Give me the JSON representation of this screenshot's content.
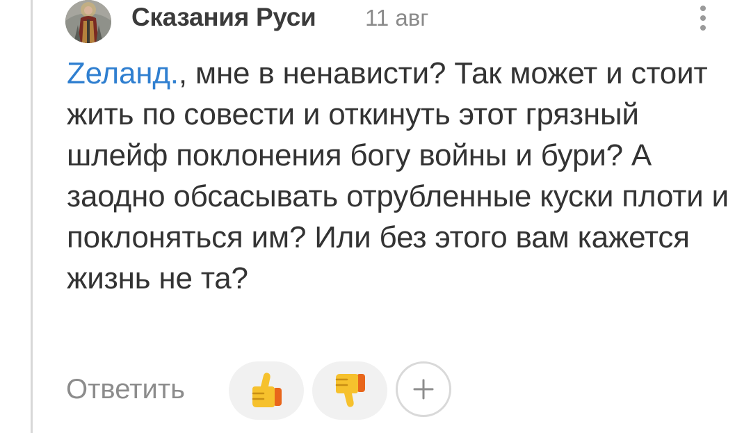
{
  "comment": {
    "author": "Сказания Руси",
    "date": "11 авг",
    "mention": "Zеланд.",
    "text": ", мне в ненависти? Так может и стоит жить по совести и откинуть этот грязный шлейф поклонения богу войны и бури? А заодно обсасывать отрубленные куски плоти и поклоняться им? Или без этого вам кажется жизнь не та?",
    "avatar_icon": "warrior-saint-avatar"
  },
  "actions": {
    "reply_label": "Ответить",
    "like_icon": "thumbs-up-icon",
    "dislike_icon": "thumbs-down-icon",
    "add_icon": "plus-icon",
    "more_icon": "vertical-dots-icon"
  },
  "colors": {
    "mention": "#2f7fd0",
    "text": "#333333",
    "muted": "#8a8a8a",
    "reaction_bg": "#f1f1f1",
    "emoji_yellow": "#f6c12d",
    "emoji_orange": "#e8661b"
  }
}
